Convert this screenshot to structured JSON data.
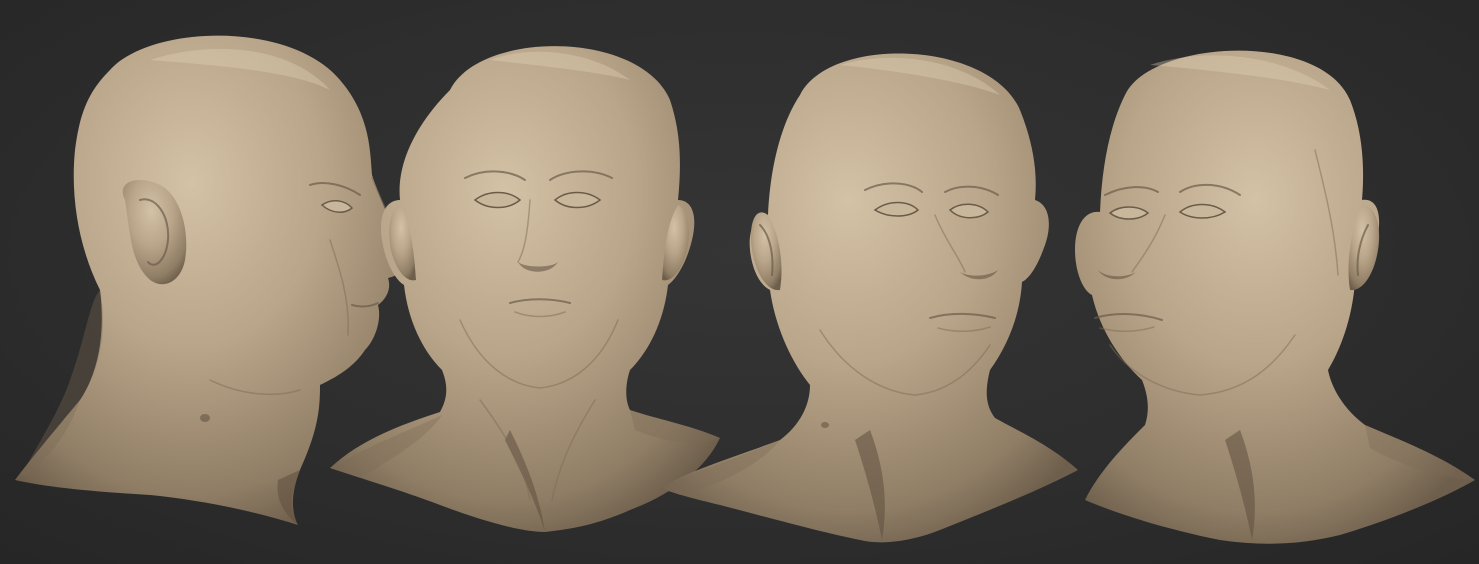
{
  "scene": {
    "background_color": "#2e2e2e",
    "skin_color": "#b9a589",
    "views": [
      {
        "name": "left-profile"
      },
      {
        "name": "front"
      },
      {
        "name": "three-quarter-right"
      },
      {
        "name": "three-quarter-left"
      }
    ]
  }
}
